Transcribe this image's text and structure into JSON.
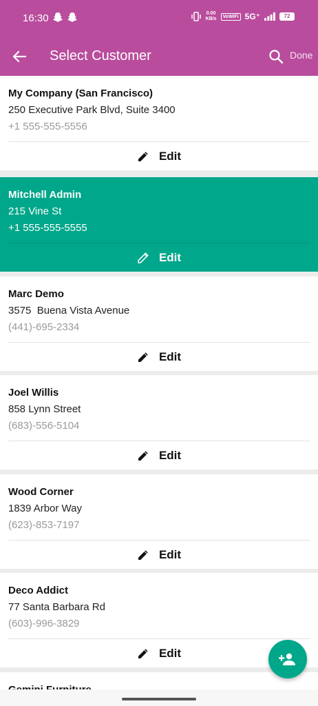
{
  "status_bar": {
    "time": "16:30",
    "speed_value": "0.00",
    "speed_unit": "KB/s",
    "volte": "VoWiFi",
    "network": "5G⁺",
    "battery": "72",
    "icons": [
      "snapchat-icon",
      "snapchat-icon",
      "vibrate-icon",
      "signal-icon",
      "battery-icon"
    ]
  },
  "app_bar": {
    "title": "Select Customer",
    "done_label": "Done",
    "background_color": "#b94c9d",
    "back_icon": "arrow-back-icon",
    "search_icon": "search-icon"
  },
  "customers": [
    {
      "name": "My Company (San Francisco)",
      "street": "250 Executive Park Blvd, Suite 3400",
      "phone": "+1 555-555-5556",
      "edit_label": "Edit",
      "selected": false
    },
    {
      "name": "Mitchell Admin",
      "street": "215 Vine St",
      "phone": "+1 555-555-5555",
      "edit_label": "Edit",
      "selected": true
    },
    {
      "name": "Marc Demo",
      "street": "3575  Buena Vista Avenue",
      "phone": "(441)-695-2334",
      "edit_label": "Edit",
      "selected": false
    },
    {
      "name": "Joel Willis",
      "street": "858 Lynn Street",
      "phone": "(683)-556-5104",
      "edit_label": "Edit",
      "selected": false
    },
    {
      "name": "Wood Corner",
      "street": "1839 Arbor Way",
      "phone": "(623)-853-7197",
      "edit_label": "Edit",
      "selected": false
    },
    {
      "name": "Deco Addict",
      "street": "77 Santa Barbara Rd",
      "phone": "(603)-996-3829",
      "edit_label": "Edit",
      "selected": false
    },
    {
      "name": "Gemini Furniture",
      "street": "",
      "phone": "",
      "edit_label": "",
      "selected": false
    }
  ],
  "colors": {
    "selected_row": "#00a78a",
    "fab": "#00a78a"
  },
  "fab": {
    "icon": "add-person-icon"
  }
}
